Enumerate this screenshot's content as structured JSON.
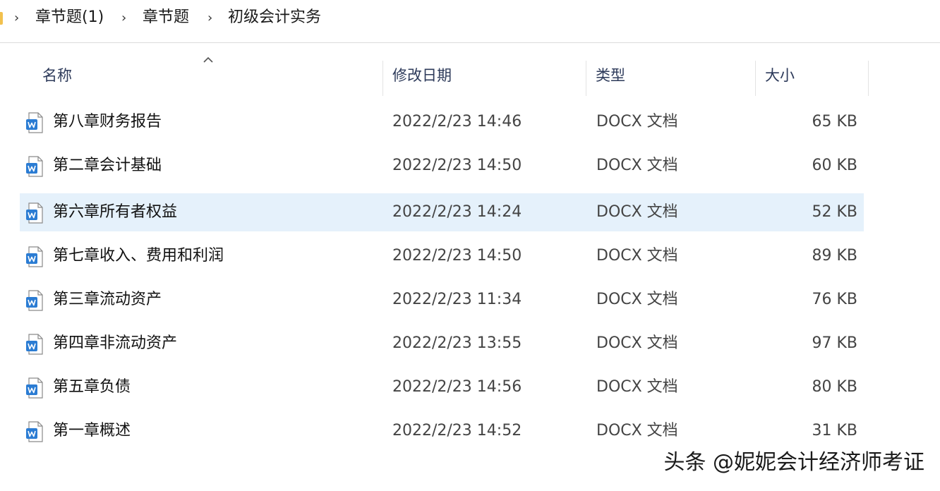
{
  "breadcrumb": {
    "items": [
      "章节题(1)",
      "章节题",
      "初级会计实务"
    ]
  },
  "columns": {
    "name": "名称",
    "date": "修改日期",
    "type": "类型",
    "size": "大小"
  },
  "files": [
    {
      "name": "第八章财务报告",
      "date": "2022/2/23 14:46",
      "type": "DOCX 文档",
      "size": "65 KB"
    },
    {
      "name": "第二章会计基础",
      "date": "2022/2/23 14:50",
      "type": "DOCX 文档",
      "size": "60 KB"
    },
    {
      "name": "第六章所有者权益",
      "date": "2022/2/23 14:24",
      "type": "DOCX 文档",
      "size": "52 KB",
      "selected": true
    },
    {
      "name": "第七章收入、费用和利润",
      "date": "2022/2/23 14:50",
      "type": "DOCX 文档",
      "size": "89 KB"
    },
    {
      "name": "第三章流动资产",
      "date": "2022/2/23 11:34",
      "type": "DOCX 文档",
      "size": "76 KB"
    },
    {
      "name": "第四章非流动资产",
      "date": "2022/2/23 13:55",
      "type": "DOCX 文档",
      "size": "97 KB"
    },
    {
      "name": "第五章负债",
      "date": "2022/2/23 14:56",
      "type": "DOCX 文档",
      "size": "80 KB"
    },
    {
      "name": "第一章概述",
      "date": "2022/2/23 14:52",
      "type": "DOCX 文档",
      "size": "31 KB"
    }
  ],
  "watermark": "头条 @妮妮会计经济师考证",
  "icons": {
    "folder": "folder-icon",
    "separator": "chevron-right-icon",
    "sort": "sort-ascending-icon",
    "file": "word-document-icon"
  },
  "colors": {
    "selected_row": "#e5f1fb",
    "word_icon": "#2b7cd3",
    "folder": "#f2c14e"
  }
}
